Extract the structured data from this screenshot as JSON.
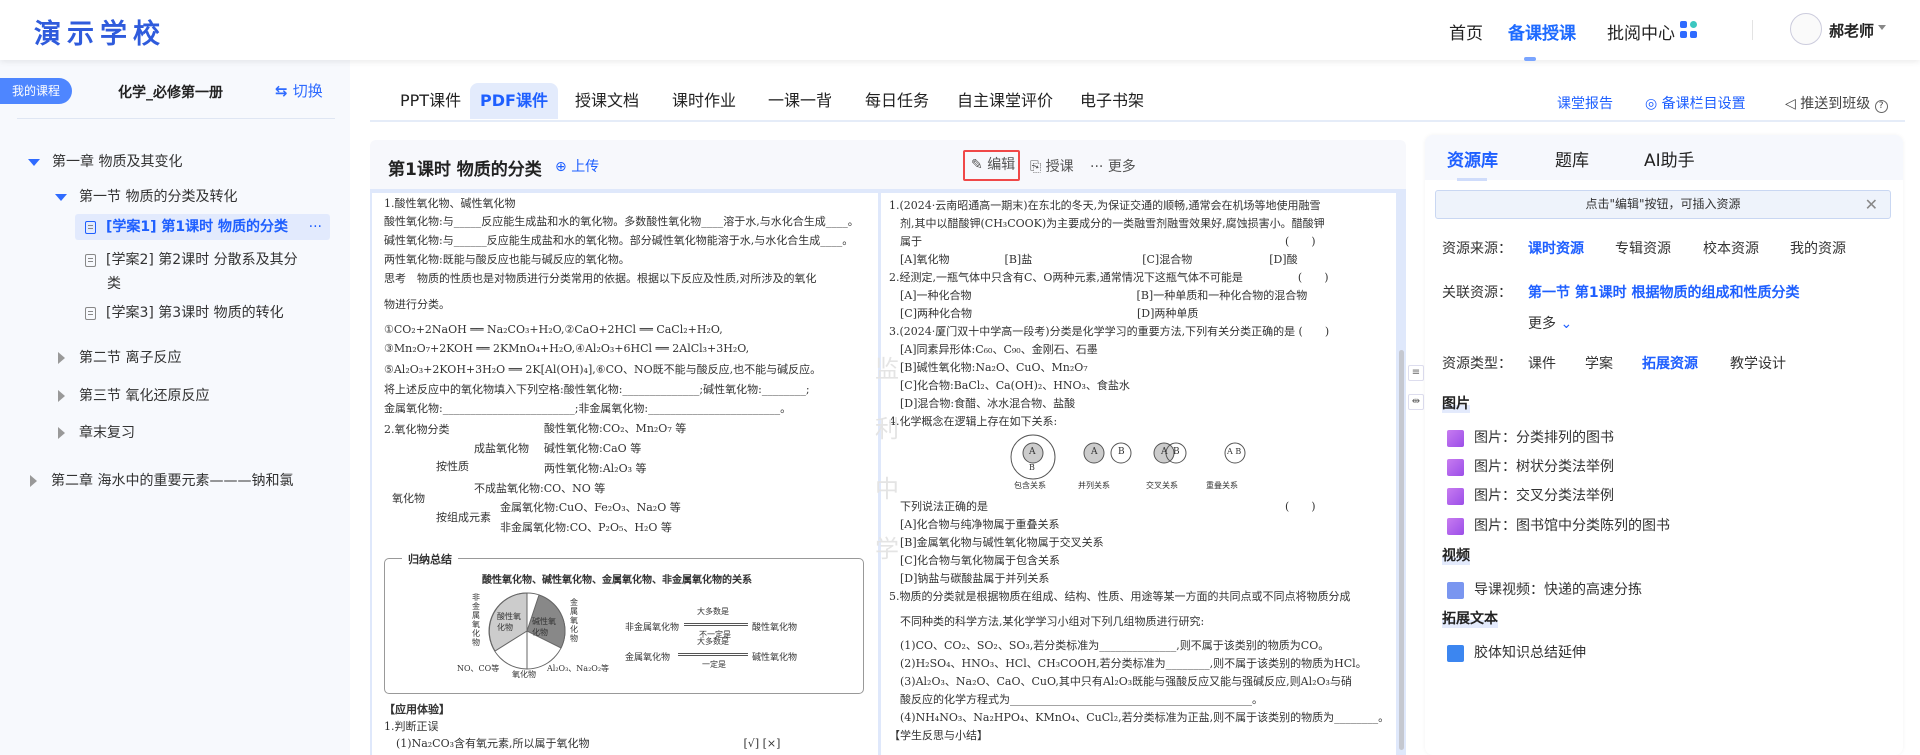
{
  "header": {
    "logo": "演示学校",
    "nav": [
      "首页",
      "备课授课",
      "批阅中心"
    ],
    "avatar_text": "头像",
    "teacher": "郝老师"
  },
  "sidebar": {
    "my_course": "我的课程",
    "course_name": "化学_必修第一册",
    "switch": "切换",
    "tree": {
      "chapter1": "第一章 物质及其变化",
      "section1": "第一节 物质的分类及转化",
      "items": [
        "[学案1] 第1课时 物质的分类",
        "[学案2] 第2课时 分散系及其分",
        "类",
        "[学案3] 第3课时 物质的转化"
      ],
      "more": "···",
      "section2": "第二节 离子反应",
      "section3": "第三节 氧化还原反应",
      "review": "章末复习",
      "chapter2": "第二章 海水中的重要元素———钠和氯"
    }
  },
  "tabs": [
    "PPT课件",
    "PDF课件",
    "授课文档",
    "课时作业",
    "一课一背",
    "每日任务",
    "自主课堂评价",
    "电子书架"
  ],
  "toplinks": {
    "report": "课堂报告",
    "settings": "备课栏目设置",
    "push": "推送到班级",
    "help": "?"
  },
  "doc": {
    "title": "第1课时 物质的分类",
    "upload": "上传",
    "edit": "编辑",
    "teach": "授课",
    "more": "更多",
    "left_lines": [
      "1.酸性氧化物、碱性氧化物",
      "酸性氧化物:与_____反应能生成盐和水的氧化物。多数酸性氧化物____溶于水,与水化合生成____。",
      "碱性氧化物:与______反应能生成盐和水的氧化物。部分碱性氧化物能溶于水,与水化合生成____。",
      "两性氧化物:既能与酸反应也能与碱反应的氧化物。",
      "思考　物质的性质也是对物质进行分类常用的依据。根据以下反应及性质,对所涉及的氧化",
      "物进行分类。",
      "①CO₂+2NaOH ══ Na₂CO₃+H₂O,②CaO+2HCl ══ CaCl₂+H₂O,",
      "③Mn₂O₇+2KOH ══ 2KMnO₄+H₂O,④Al₂O₃+6HCl ══ 2AlCl₃+3H₂O,",
      "⑤Al₂O₃+2KOH+3H₂O ══ 2K[Al(OH)₄],⑥CO、NO既不能与酸反应,也不能与碱反应。",
      "将上述反应中的氧化物填入下列空格:酸性氧化物:______________;碱性氧化物:________;",
      "金属氧化物:________________________;非金属氧化物:________________________。",
      "2.氧化物分类"
    ],
    "tree": {
      "root": "氧化物",
      "by_property": "按性质",
      "salt_forming": "成盐氧化物",
      "acidic": "酸性氧化物:CO₂、Mn₂O₇ 等",
      "basic": "碱性氧化物:CaO 等",
      "amphoteric": "两性氧化物:Al₂O₃ 等",
      "non_salt": "不成盐氧化物:CO、NO 等",
      "by_element": "按组成元素",
      "metal": "金属氧化物:CuO、Fe₂O₃、Na₂O 等",
      "nonmetal": "非金属氧化物:CO、P₂O₅、H₂O 等"
    },
    "summary": {
      "label": "归纳总结",
      "title": "酸性氧化物、碱性氧化物、金属氧化物、非金属氧化物的关系",
      "pie_acid": "酸性氧化物",
      "pie_base": "碱性氧化物",
      "nonmetal_side": "非金属氧化物",
      "metal_side": "金属氧化物",
      "no_co": "NO、CO等",
      "oxide": "氧化物",
      "al_na": "Al₂O₃、Na₂O₂等",
      "r1_left": "非金属氧化物",
      "r1_top": "大多数是",
      "r1_bottom": "不一定是",
      "r1_right": "酸性氧化物",
      "r2_left": "金属氧化物",
      "r2_top": "大多数是",
      "r2_bottom": "一定是",
      "r2_right": "碱性氧化物"
    },
    "left_bottom": [
      "【应用体验】",
      "1.判断正误",
      "(1)Na₂CO₃含有氧元素,所以属于氧化物　　　　　　　　　　　　　　[√] [×]"
    ],
    "right_lines": [
      "1.(2024·云南昭通高一期末)在东北的冬天,为保证交通的顺畅,通常会在机场等地使用融雪",
      "　剂,其中以醋酸钾(CH₃COOK)为主要成分的一类融雪剂融雪效果好,腐蚀损害小。醋酸钾",
      "　属于　　　　　　　　　　　　　　　　　　　　　　　　　　　　　　　　　(　　)",
      "　[A]氧化物　　　　　[B]盐　　　　　　　　　　[C]混合物　　　　　　　[D]酸",
      "2.经测定,一瓶气体中只含有C、O两种元素,通常情况下这瓶气体不可能是　　　　　(　　)",
      "　[A]一种化合物　　　　　　　　　　　　　　　[B]一种单质和一种化合物的混合物",
      "　[C]两种化合物　　　　　　　　　　　　　　　[D]两种单质",
      "3.(2024·厦门双十中学高一段考)分类是化学学习的重要方法,下列有关分类正确的是 (　　)",
      "　[A]同素异形体:C₆₀、C₉₀、金刚石、石墨",
      "　[B]碱性氧化物:Na₂O、CuO、Mn₂O₇",
      "　[C]化合物:BaCl₂、Ca(OH)₂、HNO₃、食盐水",
      "　[D]混合物:食醋、冰水混合物、盐酸",
      "4.化学概念在逻辑上存在如下关系:"
    ],
    "venn": {
      "a": "A",
      "b": "B",
      "ab": "A B",
      "labels": [
        "包含关系",
        "并列关系",
        "交叉关系",
        "重叠关系"
      ]
    },
    "right_lines2": [
      "　下列说法正确的是　　　　　　　　　　　　　　　　　　　　　　　　　　　(　　)",
      "　[A]化合物与纯净物属于重叠关系",
      "　[B]金属氧化物与碱性氧化物属于交叉关系",
      "　[C]化合物与氧化物属于包含关系",
      "　[D]钠盐与碳酸盐属于并列关系",
      "5.物质的分类就是根据物质在组成、结构、性质、用途等某一方面的共同点或不同点将物质分成",
      "　不同种类的科学方法,某化学学习小组对下列几组物质进行研究:",
      "　(1)CO、CO₂、SO₂、SO₃,若分类标准为______________,则不属于该类别的物质为CO。",
      "　(2)H₂SO₄、HNO₃、HCl、CH₃COOH,若分类标准为________,则不属于该类别的物质为HCl。",
      "　(3)Al₂O₃、Na₂O、CaO、CuO,其中只有Al₂O₃既能与强酸反应又能与强碱反应,则Al₂O₃与硝",
      "　酸反应的化学方程式为____________________________________________。",
      "　(4)NH₄NO₃、Na₂HPO₄、KMnO₄、CuCl₂,若分类标准为正盐,则不属于该类别的物质为________。",
      "【学生反思与小结】"
    ],
    "watermark": "监利中学"
  },
  "resources": {
    "tabs": [
      "资源库",
      "题库",
      "AI助手"
    ],
    "notice": "点击\"编辑\"按钮，可插入资源",
    "source_label": "资源来源：",
    "sources": [
      "课时资源",
      "专辑资源",
      "校本资源",
      "我的资源"
    ],
    "related_label": "关联资源：",
    "related": "第一节 第1课时 根据物质的组成和性质分类",
    "more": "更多",
    "type_label": "资源类型：",
    "types": [
      "课件",
      "学案",
      "拓展资源",
      "教学设计"
    ],
    "sections": {
      "pictures": "图片",
      "videos": "视频",
      "texts": "拓展文本"
    },
    "pictures": [
      "图片：分类排列的图书",
      "图片：树状分类法举例",
      "图片：交叉分类法举例",
      "图片：图书馆中分类陈列的图书"
    ],
    "videos": [
      "导课视频：快递的高速分拣"
    ],
    "texts": [
      "胶体知识总结延伸"
    ]
  },
  "colors": {
    "accent": "#1e5fff",
    "highlight_border": "#f04848"
  }
}
